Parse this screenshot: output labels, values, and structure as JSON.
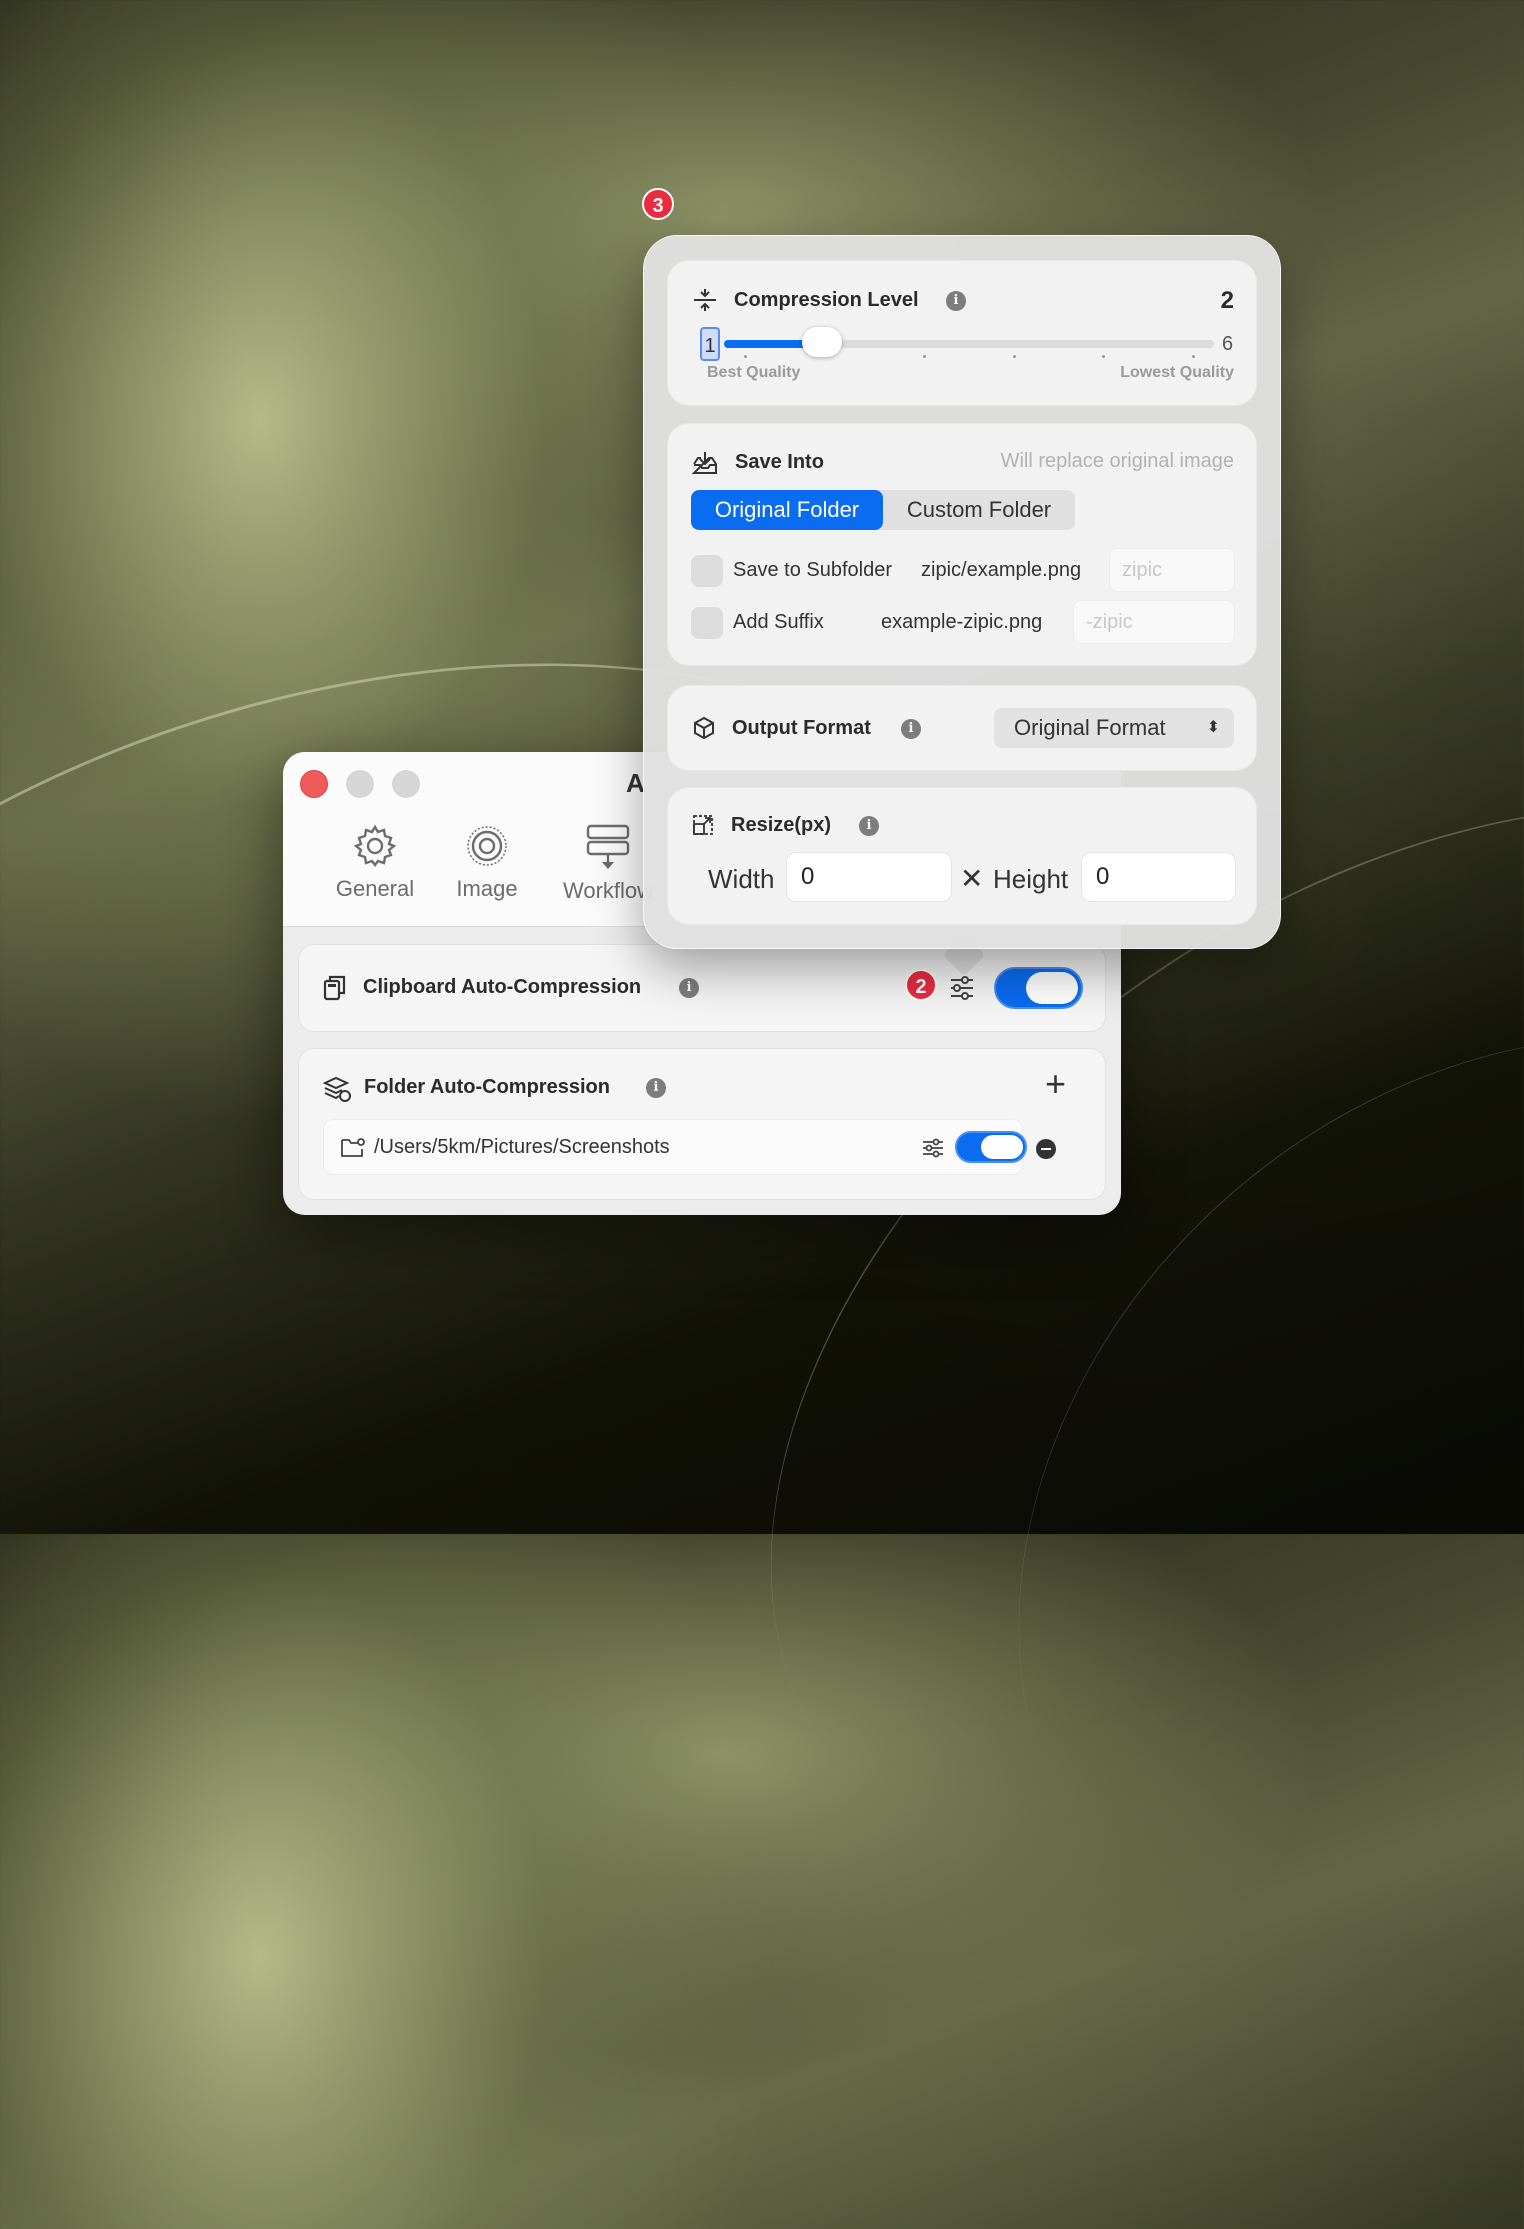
{
  "window": {
    "title_partial": "A",
    "tabs": [
      {
        "label": "General",
        "icon": "gear-icon"
      },
      {
        "label": "Image",
        "icon": "image-target-icon"
      },
      {
        "label": "Workflow",
        "icon": "workflow-icon"
      }
    ]
  },
  "clipboard": {
    "title": "Clipboard Auto-Compression",
    "enabled": true,
    "badge": "2"
  },
  "folder": {
    "title": "Folder Auto-Compression",
    "add_label": "+",
    "paths": [
      {
        "path": "/Users/5km/Pictures/Screenshots",
        "enabled": true
      }
    ]
  },
  "popover": {
    "badge": "3",
    "compression": {
      "title": "Compression Level",
      "value": "2",
      "min": "1",
      "max": "6",
      "level": 2,
      "left_caption": "Best Quality",
      "right_caption": "Lowest Quality"
    },
    "save": {
      "title": "Save Into",
      "hint": "Will replace original image",
      "options": [
        "Original Folder",
        "Custom Folder"
      ],
      "selected": "Original Folder",
      "subfolder_label": "Save to Subfolder",
      "subfolder_example": "zipic/example.png",
      "subfolder_placeholder": "zipic",
      "subfolder_checked": false,
      "suffix_label": "Add Suffix",
      "suffix_example": "example-zipic.png",
      "suffix_placeholder": "-zipic",
      "suffix_checked": false
    },
    "format": {
      "title": "Output Format",
      "selected": "Original Format"
    },
    "resize": {
      "title": "Resize(px)",
      "width_label": "Width",
      "width_value": "0",
      "height_label": "Height",
      "height_value": "0",
      "times": "✕"
    }
  },
  "colors": {
    "accent": "#0a6cf0",
    "badge": "#ea2c40",
    "close": "#ee5b5a"
  }
}
